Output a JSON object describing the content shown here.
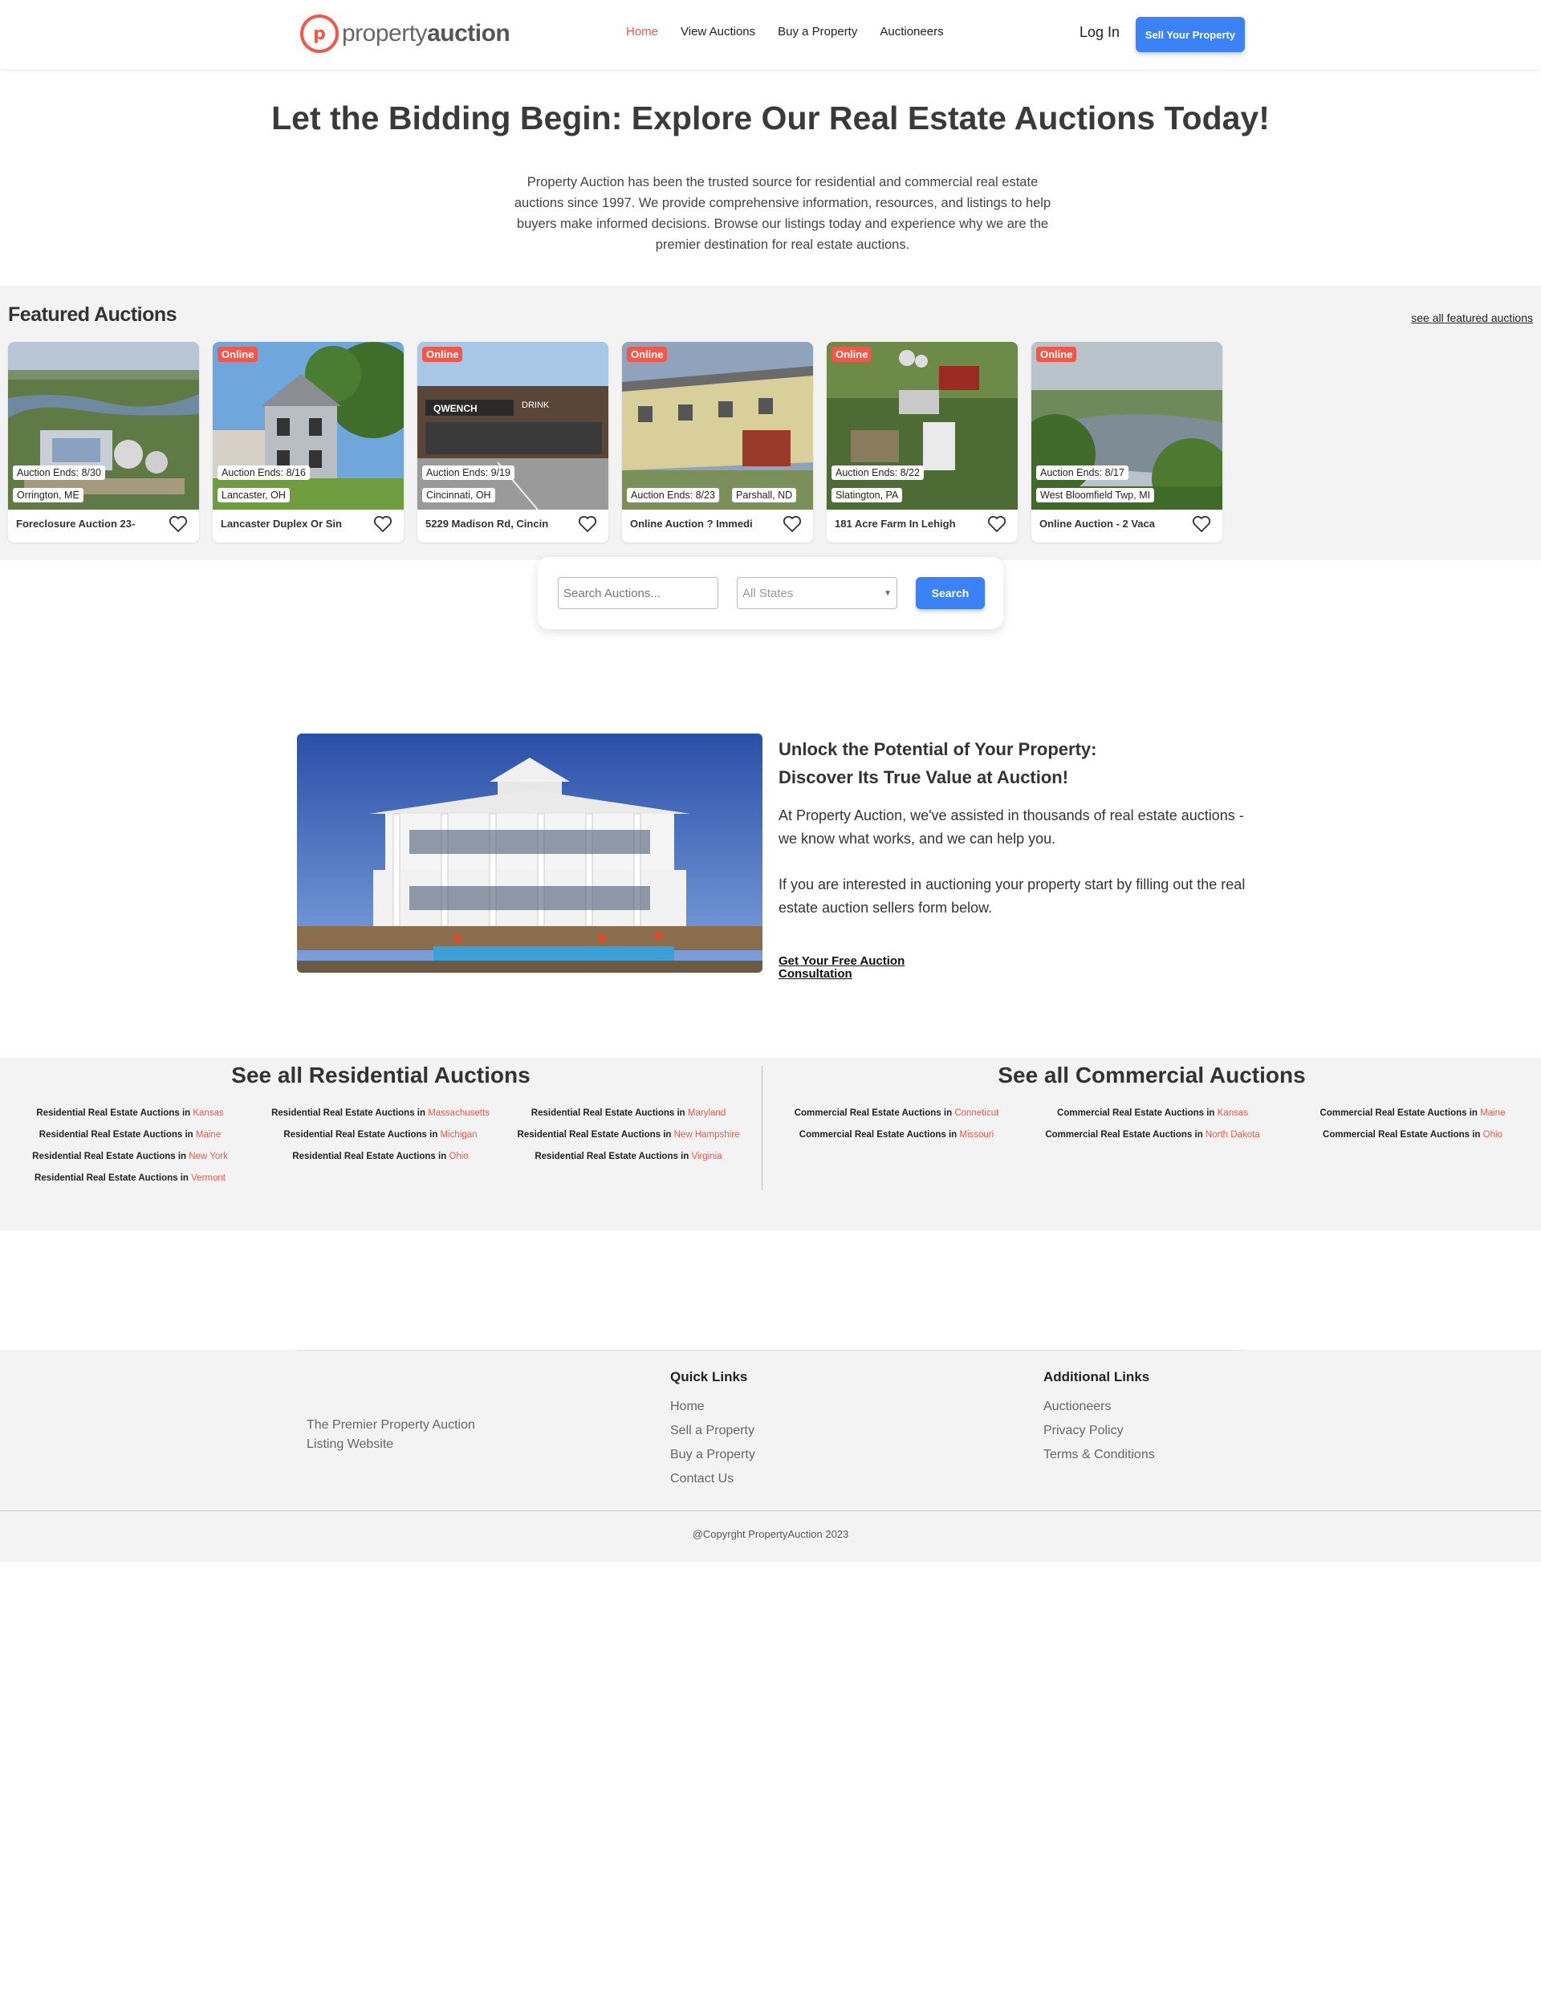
{
  "header": {
    "logo_mark": "p",
    "logo_text_light": "property",
    "logo_text_bold": "auction",
    "nav": [
      "Home",
      "View Auctions",
      "Buy a Property",
      "Auctioneers"
    ],
    "login_label": "Log In",
    "sell_label": "Sell Your Property",
    "accent": "#f1584a",
    "primary": "#3b82f6"
  },
  "hero": {
    "title": "Let the Bidding Begin: Explore Our Real Estate Auctions Today!",
    "description": "Property Auction has been the trusted source for residential and commercial real estate auctions since 1997. We provide comprehensive information, resources, and listings to help buyers make informed decisions. Browse our listings today and experience why we are the premier destination for real estate auctions."
  },
  "featured": {
    "title": "Featured Auctions",
    "see_all": "see all featured auctions",
    "cards": [
      {
        "badge": "",
        "ends": "Auction Ends: 8/30",
        "location": "Orrington, ME",
        "name": "Foreclosure Auction 23-"
      },
      {
        "badge": "Online",
        "ends": "Auction Ends: 8/16",
        "location": "Lancaster, OH",
        "name": "Lancaster Duplex Or Sin"
      },
      {
        "badge": "Online",
        "ends": "Auction Ends: 9/19",
        "location": "Cincinnati, OH",
        "name": "5229 Madison Rd, Cincin"
      },
      {
        "badge": "Online",
        "ends": "Auction Ends: 8/23",
        "location": "Parshall, ND",
        "name": "Online Auction ? Immedi"
      },
      {
        "badge": "Online",
        "ends": "Auction Ends: 8/22",
        "location": "Slatington, PA",
        "name": "181 Acre Farm In Lehigh"
      },
      {
        "badge": "Online",
        "ends": "Auction Ends: 8/17",
        "location": "West Bloomfield Twp, MI",
        "name": "Online Auction - 2 Vaca"
      }
    ]
  },
  "search": {
    "placeholder": "Search Auctions...",
    "state_default": "All States",
    "button": "Search"
  },
  "promo": {
    "title_line1": "Unlock the Potential of Your Property:",
    "title_line2": "Discover Its True Value at Auction!",
    "p1": "At Property Auction, we've assisted in thousands of real estate auctions - we know what works, and we can help you.",
    "p2": "If you are interested in auctioning your property start by filling out the real estate auction sellers form below.",
    "link": "Get Your Free Auction Consultation"
  },
  "states": {
    "residential_title": "See all Residential Auctions",
    "commercial_title": "See all Commercial Auctions",
    "residential_prefix": "Residential Real Estate Auctions in",
    "commercial_prefix": "Commercial Real Estate Auctions in",
    "residential": [
      "Kansas",
      "Massachusetts",
      "Maryland",
      "Maine",
      "Michigan",
      "New Hampshire",
      "New York",
      "Ohio",
      "Virginia",
      "Vermont"
    ],
    "commercial": [
      "Conneticut",
      "Kansas",
      "Maine",
      "Missouri",
      "North Dakota",
      "Ohio"
    ]
  },
  "footer": {
    "tagline": "The Premier Property Auction Listing Website",
    "quick_title": "Quick Links",
    "quick_links": [
      "Home",
      "Sell a Property",
      "Buy a Property",
      "Contact Us"
    ],
    "additional_title": "Additional Links",
    "additional_links": [
      "Auctioneers",
      "Privacy Policy",
      "Terms & Conditions"
    ],
    "copyright": "@Copyrght PropertyAuction 2023"
  }
}
